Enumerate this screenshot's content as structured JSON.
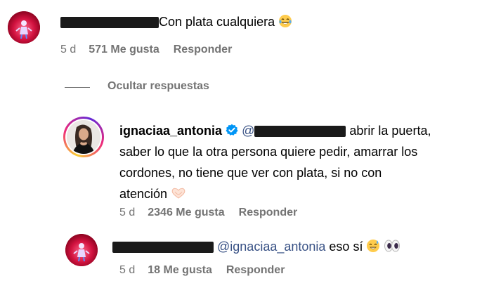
{
  "comment1": {
    "text": "Con plata cualquiera",
    "emoji": "laughing-tears-icon",
    "time": "5 d",
    "likes": "571 Me gusta",
    "reply": "Responder"
  },
  "replies_toggle": {
    "label": "Ocultar respuestas"
  },
  "comment2": {
    "username": "ignaciaa_antonia",
    "verified_icon": "verified-badge-icon",
    "mention_prefix": "@",
    "text_line1": "abrir la puerta,",
    "text_line2": "saber lo que la otra persona quiere pedir, amarrar los",
    "text_line3": "cordones, no tiene que ver con plata, si no con",
    "text_line4": "atención",
    "emoji": "heart-hands-icon",
    "time": "5 d",
    "likes": "2346 Me gusta",
    "reply": "Responder"
  },
  "comment3": {
    "mention": "@ignaciaa_antonia",
    "text": "eso sí",
    "emoji1": "sweat-smile-icon",
    "emoji2": "eyes-icon",
    "time": "5 d",
    "likes": "18 Me gusta",
    "reply": "Responder"
  },
  "colors": {
    "meta_gray": "#737373",
    "mention_blue": "#385185",
    "verified_blue": "#0095f6",
    "avatar_red": "#d1123f"
  }
}
